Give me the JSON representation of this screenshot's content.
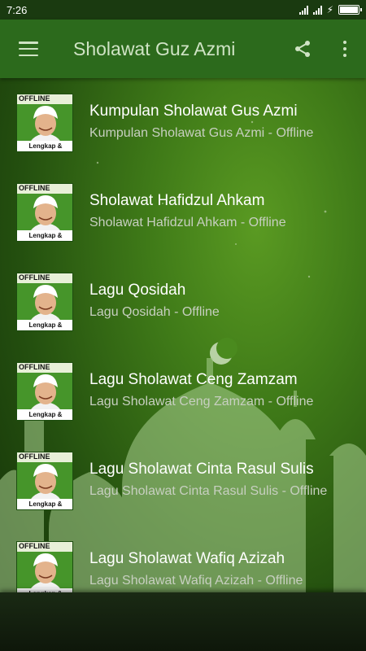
{
  "status_bar": {
    "time": "7:26",
    "icons": [
      "signal-icon",
      "signal-icon",
      "charging-icon",
      "battery-icon"
    ]
  },
  "app_bar": {
    "title": "Sholawat Guz Azmi",
    "menu_icon": "hamburger-menu-icon",
    "share_icon": "share-icon",
    "overflow_icon": "more-vert-icon"
  },
  "thumbnail": {
    "top_text": "OFFLINE",
    "bottom_text": "Lengkap & Terbaru"
  },
  "items": [
    {
      "title": "Kumpulan Sholawat Gus Azmi",
      "subtitle": "Kumpulan Sholawat Gus Azmi - Offline"
    },
    {
      "title": "Sholawat Hafidzul Ahkam",
      "subtitle": "Sholawat Hafidzul Ahkam - Offline"
    },
    {
      "title": "Lagu Qosidah",
      "subtitle": "Lagu Qosidah - Offline"
    },
    {
      "title": "Lagu Sholawat Ceng Zamzam",
      "subtitle": "Lagu Sholawat Ceng Zamzam - Offline"
    },
    {
      "title": "Lagu Sholawat Cinta Rasul Sulis",
      "subtitle": "Lagu Sholawat Cinta Rasul Sulis - Offline"
    },
    {
      "title": "Lagu Sholawat Wafiq Azizah",
      "subtitle": "Lagu Sholawat Wafiq Azizah - Offline"
    }
  ],
  "colors": {
    "app_bar": "#2c6a1c",
    "status_bar": "#1a3a10",
    "title_text": "#ffffff",
    "subtitle_text": "#c7cfc0"
  }
}
